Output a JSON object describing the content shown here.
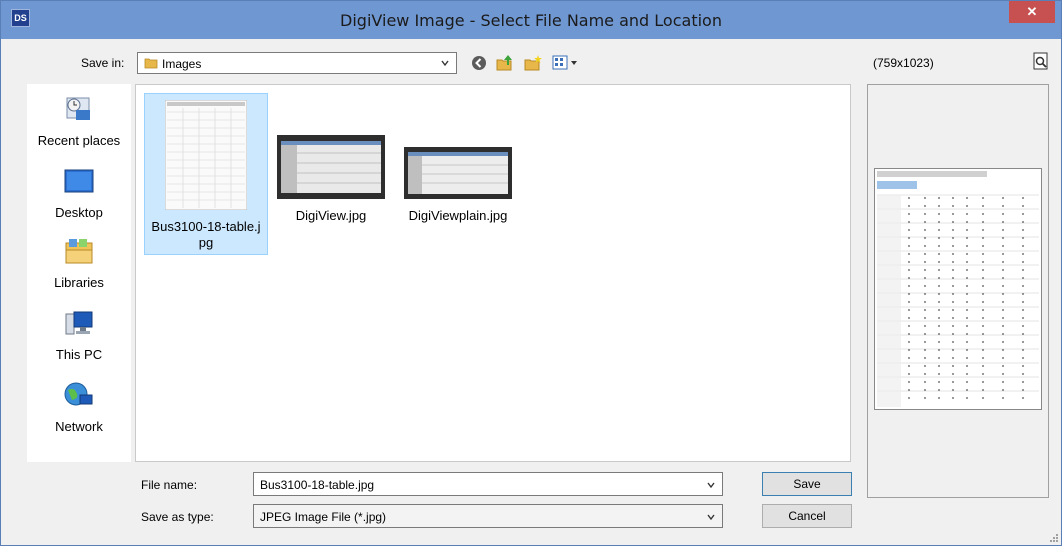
{
  "window": {
    "title": "DigiView Image - Select File Name and Location",
    "app_icon": "DS",
    "close_label": "✕"
  },
  "toolbar": {
    "save_in_label": "Save in:",
    "save_in_value": "Images",
    "buttons": [
      "back-icon",
      "up-folder-icon",
      "new-folder-icon",
      "view-menu-icon"
    ]
  },
  "places": [
    {
      "label": "Recent places",
      "icon": "recent-places-icon"
    },
    {
      "label": "Desktop",
      "icon": "desktop-icon"
    },
    {
      "label": "Libraries",
      "icon": "libraries-icon"
    },
    {
      "label": "This PC",
      "icon": "this-pc-icon"
    },
    {
      "label": "Network",
      "icon": "network-icon"
    }
  ],
  "files": [
    {
      "name": "Bus3100-18-table.jpg",
      "line1": "Bus3100-18-table.j",
      "line2": "pg",
      "selected": true
    },
    {
      "name": "DigiView.jpg",
      "line1": "DigiView.jpg",
      "line2": "",
      "selected": false
    },
    {
      "name": "DigiViewplain.jpg",
      "line1": "DigiViewplain.jpg",
      "line2": "",
      "selected": false
    }
  ],
  "preview": {
    "dimensions": "(759x1023)"
  },
  "form": {
    "file_name_label": "File name:",
    "file_name_value": "Bus3100-18-table.jpg",
    "save_as_type_label": "Save as type:",
    "save_as_type_value": "JPEG Image File (*.jpg)"
  },
  "buttons": {
    "save": "Save",
    "cancel": "Cancel"
  }
}
